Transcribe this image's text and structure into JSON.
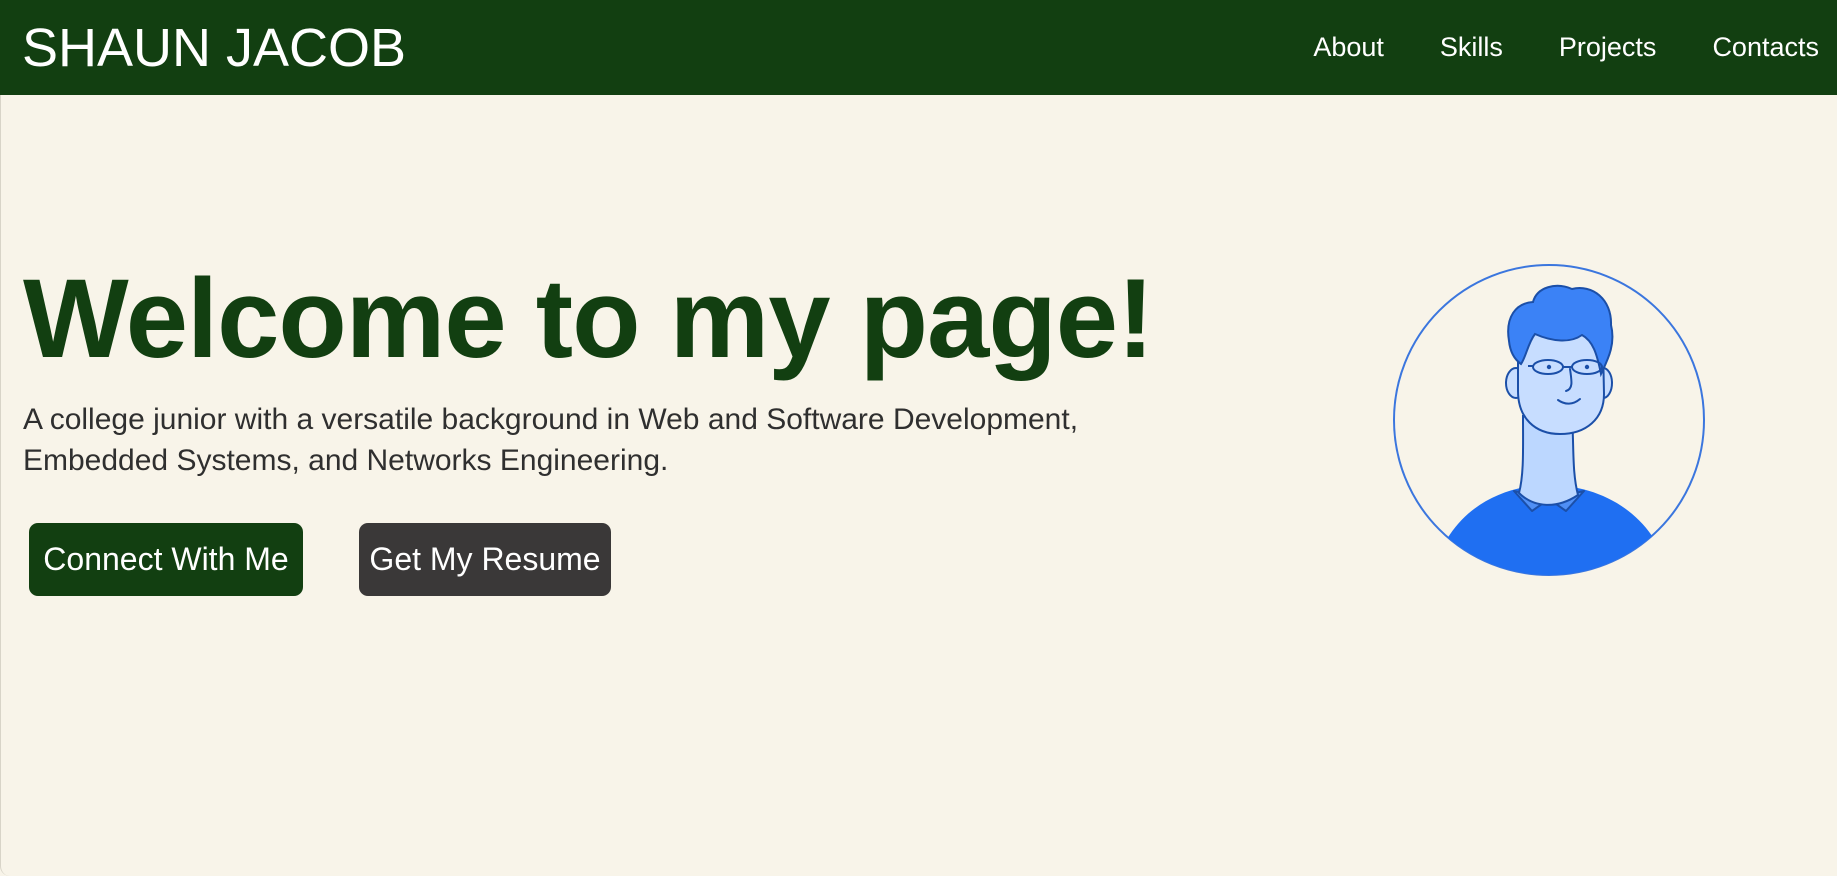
{
  "header": {
    "brand": "SHAUN JACOB",
    "nav": [
      {
        "label": "About"
      },
      {
        "label": "Skills"
      },
      {
        "label": "Projects"
      },
      {
        "label": "Contacts"
      }
    ]
  },
  "hero": {
    "title": "Welcome to my page!",
    "description": "A college junior with a versatile background in Web and Software Development, Embedded Systems, and Networks Engineering.",
    "buttons": {
      "connect": "Connect With Me",
      "resume": "Get My Resume"
    },
    "avatar_icon": "person-avatar-icon"
  },
  "colors": {
    "header_bg": "#123f11",
    "page_bg": "#f8f4e9",
    "title": "#123f11",
    "connect_button": "#123f11",
    "resume_button": "#3a3838",
    "avatar_blue": "#1f6ff2"
  }
}
